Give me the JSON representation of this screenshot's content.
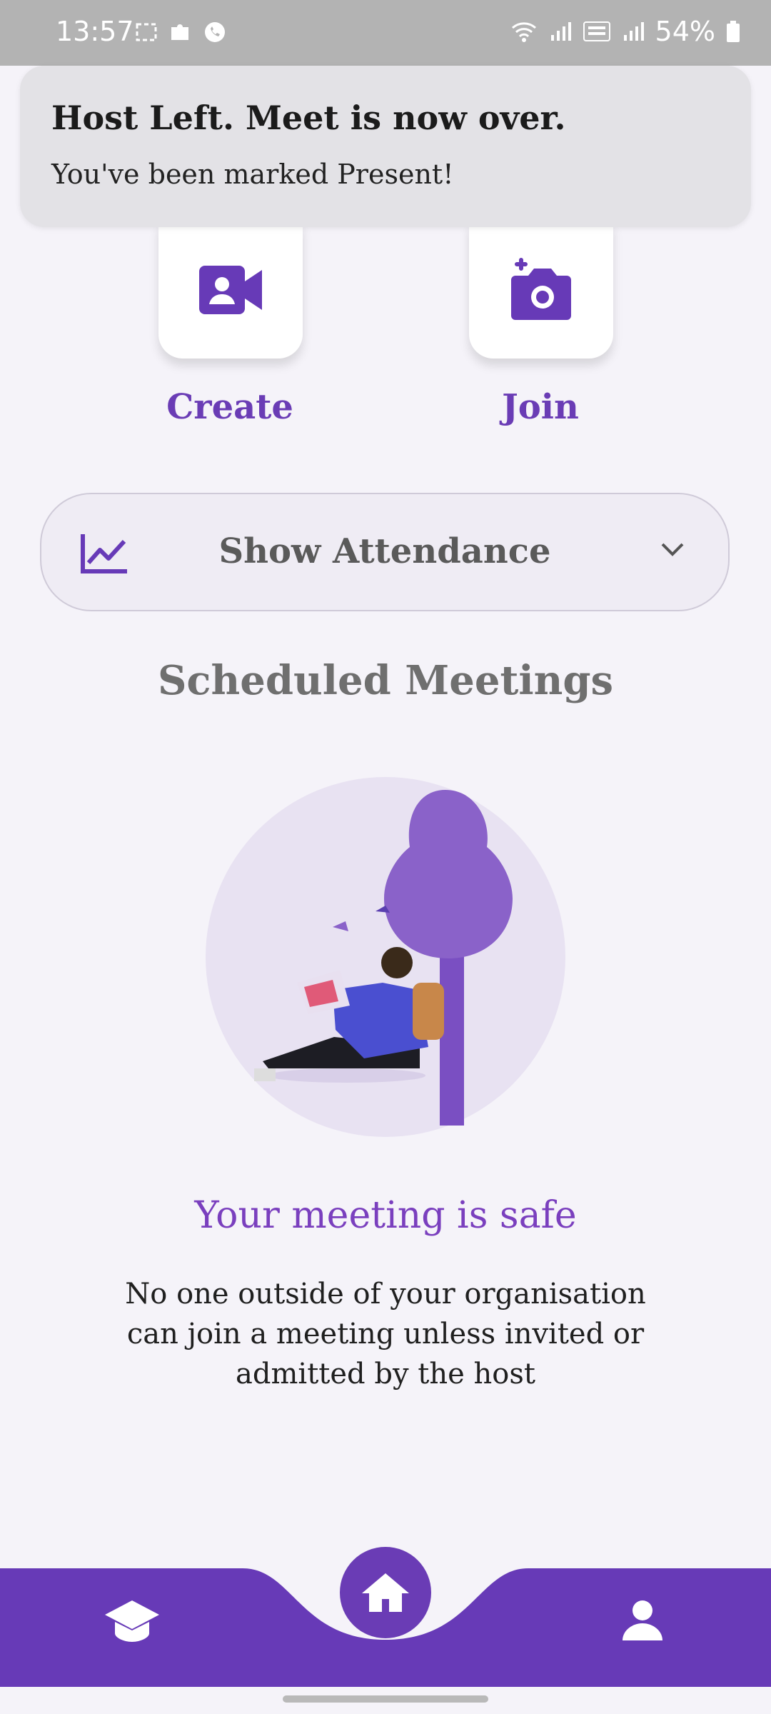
{
  "status_bar": {
    "time": "13:57",
    "battery": "54%",
    "icons": [
      "screenshot-icon",
      "puzzle-icon",
      "whatsapp-icon",
      "wifi-icon",
      "signal-icon",
      "volte-icon",
      "signal2-icon",
      "battery-icon"
    ]
  },
  "toast": {
    "title": "Host Left. Meet is now over.",
    "message": "You've been marked Present!"
  },
  "actions": {
    "create_label": "Create",
    "join_label": "Join"
  },
  "attendance": {
    "label": "Show Attendance"
  },
  "scheduled": {
    "title": "Scheduled Meetings"
  },
  "empty_state": {
    "title": "Your meeting is safe",
    "body": "No one outside of your organisation can join a meeting unless invited or admitted by the host"
  },
  "nav": {
    "items": [
      "school-icon",
      "home-icon",
      "person-icon"
    ],
    "active": "home"
  },
  "colors": {
    "primary": "#673ab7",
    "background": "#f5f3f9",
    "toast_bg": "#e3e2e6"
  }
}
